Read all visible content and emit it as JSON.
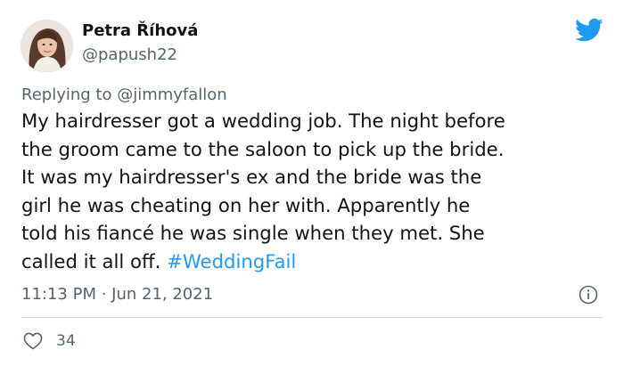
{
  "author": {
    "name": "Petra Říhová",
    "handle": "@papush22"
  },
  "reply": {
    "prefix": "Replying to ",
    "to": "@jimmyfallon"
  },
  "tweet": {
    "lines": [
      "My hairdresser got a wedding job. The night before",
      "the groom came to the saloon to pick up the bride.",
      "It was my hairdresser's ex and the bride was the",
      "girl he was cheating on her with. Apparently he",
      "told his fiancé he was single when they met. She"
    ],
    "last_line": "called it all off. ",
    "hashtag": "#WeddingFail"
  },
  "meta": {
    "time": "11:13 PM",
    "separator": " · ",
    "date": "Jun 21, 2021"
  },
  "likes": {
    "count": "34"
  },
  "colors": {
    "brand": "#1d9bf0",
    "text": "#0f1419",
    "secondary": "#536471",
    "divider": "#cfd9de"
  },
  "icons": {
    "logo": "twitter-bird-icon",
    "info": "info-icon",
    "like": "heart-icon"
  }
}
